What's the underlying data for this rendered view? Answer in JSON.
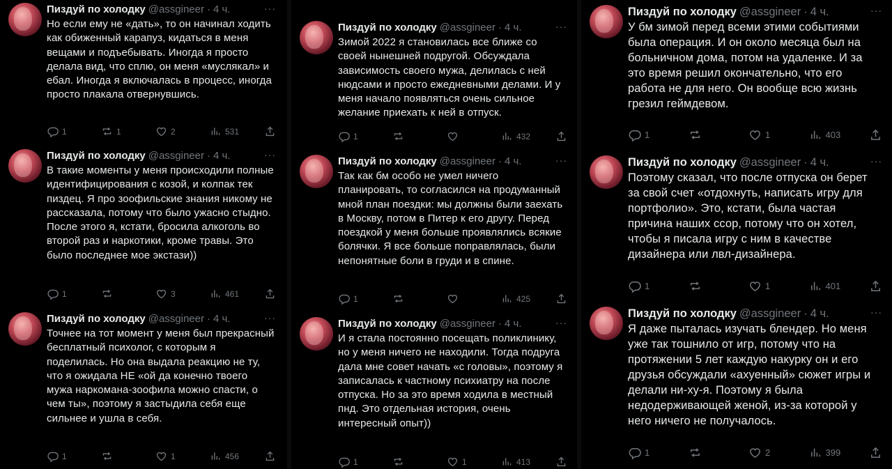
{
  "tweets": [
    {
      "name": "Пиздуй по холодку",
      "handle": "@assgineer",
      "time": "4 ч.",
      "more": "···",
      "text": "Но если ему не «дать», то он начинал ходить как обиженный карапуз, кидаться в меня вещами и подъебывать. Иногда я просто делала вид, что сплю, он меня «муслякал» и ебал. Иногда я включалась в процесс, иногда просто плакала отвернувшись.",
      "replies": "1",
      "retweets": "1",
      "likes": "2",
      "views": "531"
    },
    {
      "name": "Пиздуй по холодку",
      "handle": "@assgineer",
      "time": "4 ч.",
      "more": "···",
      "text": "В такие моменты у меня происходили полные идентифицирования с козой, и колпак тек пиздец. Я про зоофильские знания никому не рассказала, потому что было ужасно стыдно. После этого я, кстати, бросила алкоголь во второй раз и наркотики, кроме травы. Это было последнее мое экстази))",
      "replies": "1",
      "retweets": "",
      "likes": "3",
      "views": "461"
    },
    {
      "name": "Пиздуй по холодку",
      "handle": "@assgineer",
      "time": "4 ч.",
      "more": "···",
      "text": "Точнее на тот момент у меня был прекрасный бесплатный психолог, с которым я поделилась. Но она выдала реакцию не ту, что я ожидала НЕ «ой да конечно твоего мужа наркомана-зоофила можно спасти, о чем ты», поэтому я застыдила себя еще сильнее и ушла в себя.",
      "replies": "1",
      "retweets": "",
      "likes": "1",
      "views": "456"
    },
    {
      "name": "Пиздуй по холодку",
      "handle": "@assgineer",
      "time": "4 ч.",
      "more": "···",
      "text": "Зимой 2022 я становилась все ближе со своей нынешней подругой. Обсуждала зависимость своего мужа, делилась с ней нюдсами и просто ежедневными делами. И у меня начало появляться очень сильное желание приехать к ней в отпуск.",
      "replies": "1",
      "retweets": "",
      "likes": "",
      "views": "432"
    },
    {
      "name": "Пиздуй по холодку",
      "handle": "@assgineer",
      "time": "4 ч.",
      "more": "···",
      "text": "Так как бм особо не умел ничего планировать, то согласился на продуманный мной план поездки: мы должны были заехать в Москву, потом в Питер к его другу. Перед поездкой у меня больше проявлялись всякие болячки. Я все больше поправлялась, были непонятные боли в груди и в спине.",
      "replies": "1",
      "retweets": "",
      "likes": "",
      "views": "425"
    },
    {
      "name": "Пиздуй по холодку",
      "handle": "@assgineer",
      "time": "4 ч.",
      "more": "···",
      "text": "И я стала постоянно посещать поликлинику, но у меня ничего не находили. Тогда подруга дала мне совет начать «с головы», поэтому я записалась к частному психиатру на после отпуска. Но за это время ходила в местный пнд. Это отдельная история, очень интересный опыт))",
      "replies": "1",
      "retweets": "",
      "likes": "1",
      "views": "413"
    },
    {
      "name": "Пиздуй по холодку",
      "handle": "@assgineer",
      "time": "4 ч.",
      "more": "···",
      "text": "У бм зимой перед всеми этими событиями была операция. И он около месяца был на больничном дома, потом на удаленке. И за это время решил окончательно, что его работа не для него. Он вообще всю жизнь грезил геймдевом.",
      "replies": "1",
      "retweets": "",
      "likes": "1",
      "views": "403"
    },
    {
      "name": "Пиздуй по холодку",
      "handle": "@assgineer",
      "time": "4 ч.",
      "more": "···",
      "text": "Поэтому сказал, что после отпуска он берет за свой счет «отдохнуть, написать игру для портфолио». Это, кстати, была частая причина наших ссор, потому что он хотел, чтобы я писала игру с ним в качестве дизайнера или лвл-дизайнера.",
      "replies": "1",
      "retweets": "",
      "likes": "1",
      "views": "401"
    },
    {
      "name": "Пиздуй по холодку",
      "handle": "@assgineer",
      "time": "4 ч.",
      "more": "···",
      "text": "Я даже пыталась изучать блендер. Но меня уже так тошнило от игр, потому что на протяжении 5 лет каждую накурку он и его друзья обсуждали «ахуенный» сюжет игры и делали ни-ху-я. Поэтому я была недодерживающей женой, из-за которой у него ничего не получалось.",
      "replies": "1",
      "retweets": "",
      "likes": "2",
      "views": "399"
    }
  ],
  "icons": {
    "reply": "reply-icon",
    "retweet": "retweet-icon",
    "like": "heart-icon",
    "views": "views-icon",
    "share": "share-icon"
  },
  "colors": {
    "background": "#000000",
    "text": "#e7e9ea",
    "muted": "#71767b"
  }
}
